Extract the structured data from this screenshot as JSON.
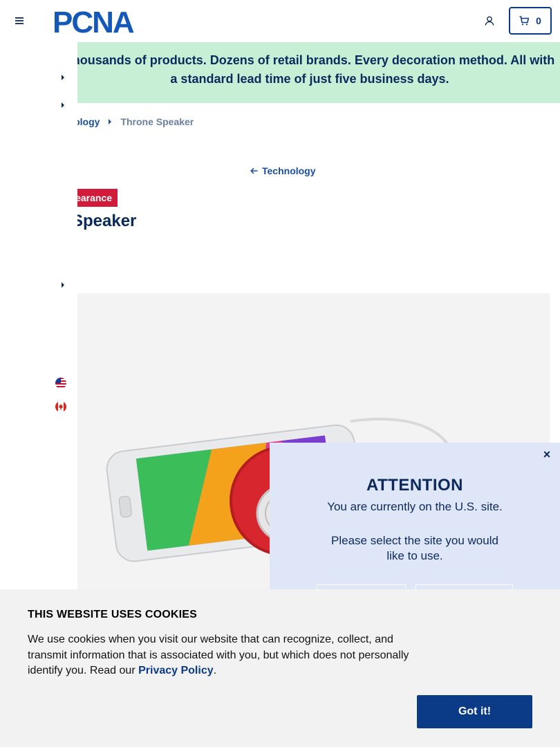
{
  "header": {
    "logo_text": "PCNA",
    "cart_count": "0"
  },
  "banner": {
    "text": "Thousands of products. Dozens of retail brands. Every decoration method. All with a standard lead time of just five business days."
  },
  "breadcrumb": {
    "parent": "Technology",
    "parent_visible": "nnology",
    "current": "Throne Speaker"
  },
  "back_link": {
    "label": "Technology"
  },
  "product": {
    "badge": "Clearance",
    "badge_visible": "earance",
    "title": "Throne Speaker",
    "title_visible": "Speaker"
  },
  "attention": {
    "title": "ATTENTION",
    "line1": "You are currently on the U.S. site.",
    "line2": "Please select the site you would like to use."
  },
  "cookie": {
    "title": "THIS WEBSITE USES COOKIES",
    "text_before": "We use cookies when you visit our website that can recognize, collect, and transmit information that is associated with you, but which does not personally identify you. Read our ",
    "link": "Privacy Policy",
    "text_after": ".",
    "button": "Got it!"
  },
  "colors": {
    "brand_blue": "#0b3a86",
    "banner_green": "#c6efd6",
    "clearance_red": "#d21a3a",
    "popup_bg": "#dfe6f8"
  }
}
